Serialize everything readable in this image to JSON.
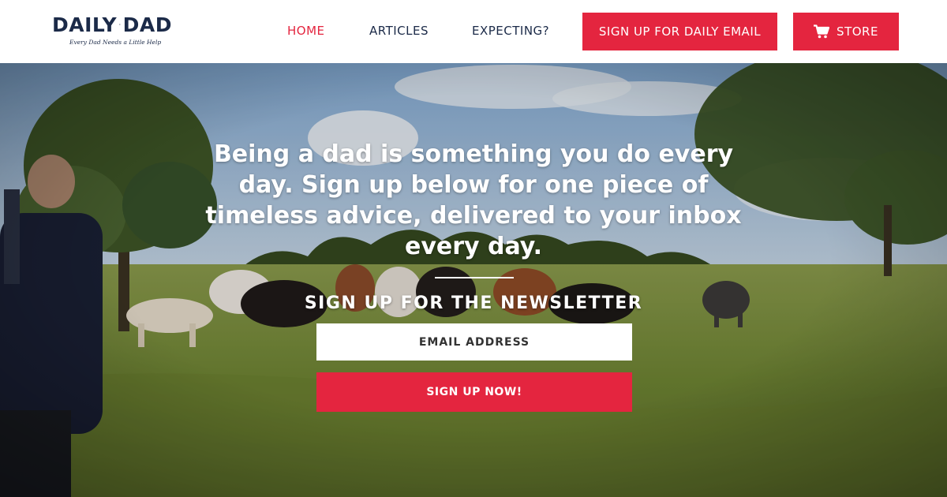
{
  "brand": {
    "logo_left": "DAILY",
    "logo_right": "DAD",
    "tagline": "Every Dad Needs a Little Help",
    "navy": "#1b2a48",
    "red": "#e4253f"
  },
  "nav": {
    "items": [
      {
        "label": "HOME",
        "active": true
      },
      {
        "label": "ARTICLES",
        "active": false
      },
      {
        "label": "EXPECTING?",
        "active": false
      }
    ],
    "signup_button": "SIGN UP FOR DAILY EMAIL",
    "store_button": "STORE",
    "store_icon": "cart-icon"
  },
  "hero": {
    "headline": "Being a dad is something you do every day. Sign up below for one piece of timeless advice, delivered to your inbox every day.",
    "newsletter_title": "SIGN UP FOR THE NEWSLETTER",
    "email_placeholder": "EMAIL ADDRESS",
    "submit_label": "SIGN UP NOW!",
    "background": "pasture-with-cattle-photo"
  }
}
